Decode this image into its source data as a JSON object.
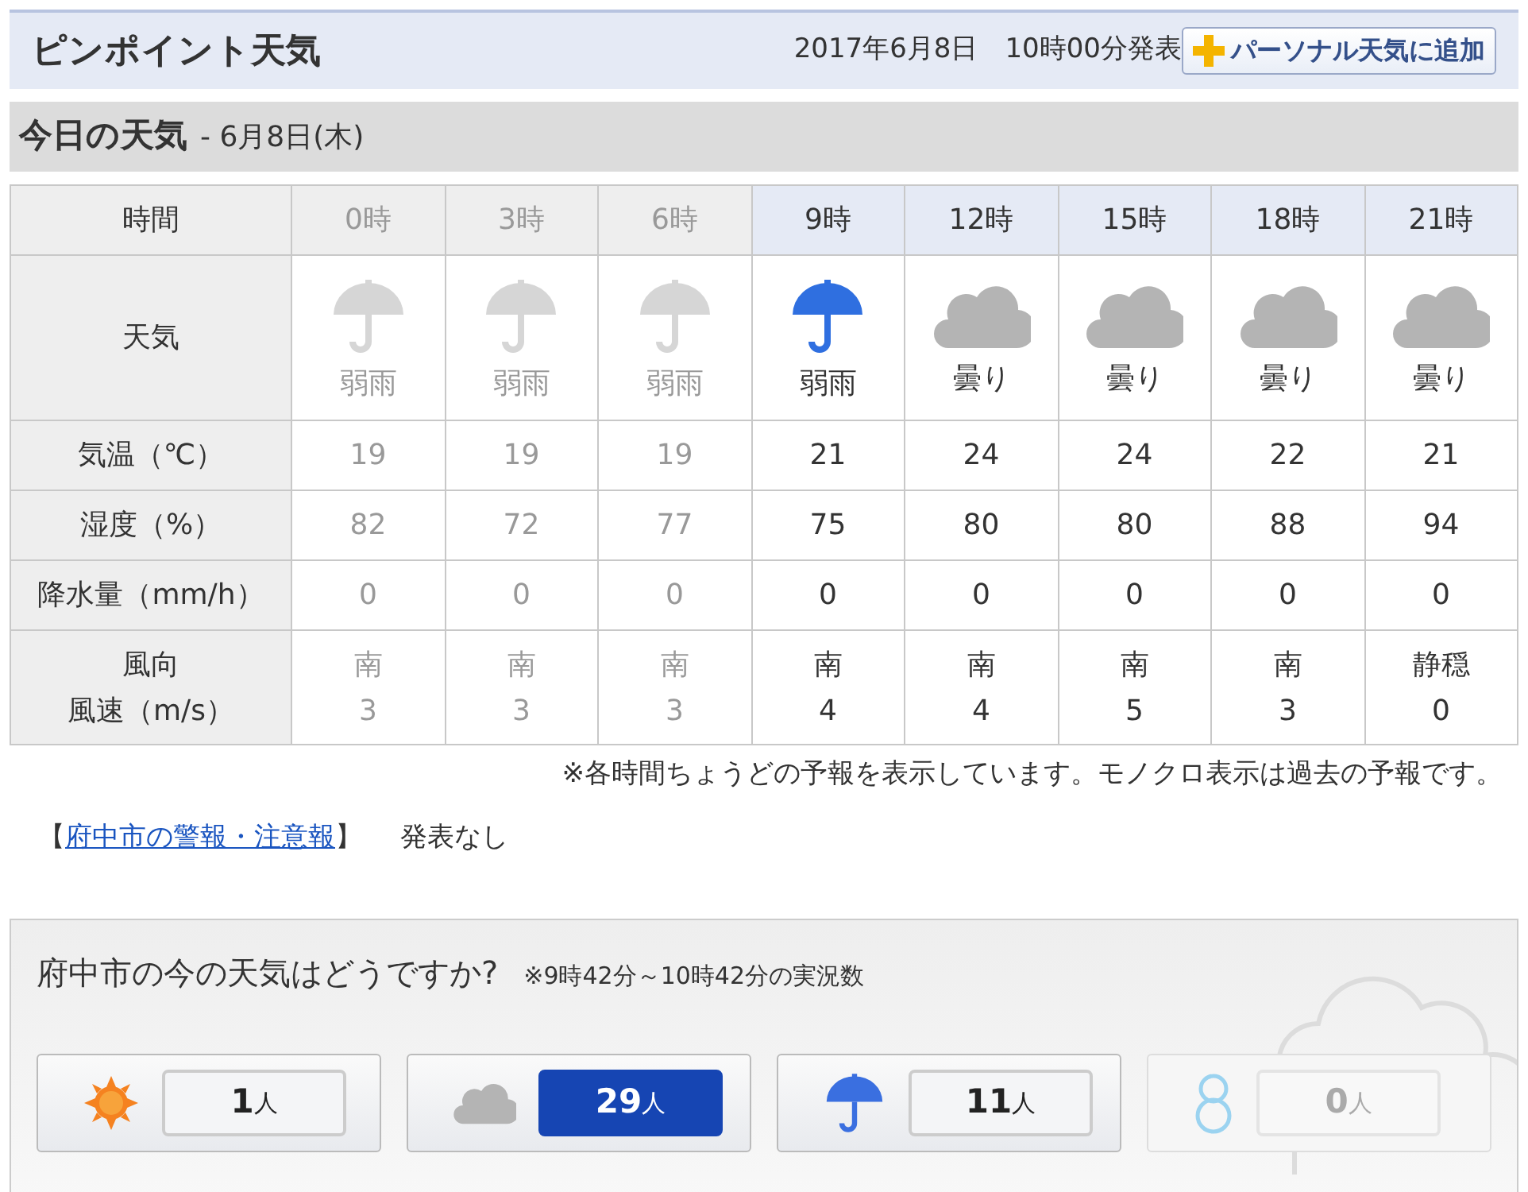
{
  "header": {
    "title": "ピンポイント天気",
    "issued": "2017年6月8日　10時00分発表",
    "add_button": "パーソナル天気に追加"
  },
  "today": {
    "title": "今日の天気",
    "date": "- 6月8日(木)"
  },
  "table": {
    "row_labels": {
      "time": "時間",
      "weather": "天気",
      "temp": "気温（℃）",
      "humidity": "湿度（%）",
      "precip": "降水量（mm/h）",
      "wind_dir": "風向",
      "wind_speed": "風速（m/s）"
    },
    "columns": [
      {
        "time": "0時",
        "past": true,
        "kind": "rain",
        "weather": "弱雨",
        "temp": "19",
        "humidity": "82",
        "precip": "0",
        "wind_dir": "南",
        "wind_speed": "3"
      },
      {
        "time": "3時",
        "past": true,
        "kind": "rain",
        "weather": "弱雨",
        "temp": "19",
        "humidity": "72",
        "precip": "0",
        "wind_dir": "南",
        "wind_speed": "3"
      },
      {
        "time": "6時",
        "past": true,
        "kind": "rain",
        "weather": "弱雨",
        "temp": "19",
        "humidity": "77",
        "precip": "0",
        "wind_dir": "南",
        "wind_speed": "3"
      },
      {
        "time": "9時",
        "past": false,
        "kind": "rain",
        "weather": "弱雨",
        "temp": "21",
        "humidity": "75",
        "precip": "0",
        "wind_dir": "南",
        "wind_speed": "4"
      },
      {
        "time": "12時",
        "past": false,
        "kind": "cloud",
        "weather": "曇り",
        "temp": "24",
        "humidity": "80",
        "precip": "0",
        "wind_dir": "南",
        "wind_speed": "4"
      },
      {
        "time": "15時",
        "past": false,
        "kind": "cloud",
        "weather": "曇り",
        "temp": "24",
        "humidity": "80",
        "precip": "0",
        "wind_dir": "南",
        "wind_speed": "5"
      },
      {
        "time": "18時",
        "past": false,
        "kind": "cloud",
        "weather": "曇り",
        "temp": "22",
        "humidity": "88",
        "precip": "0",
        "wind_dir": "南",
        "wind_speed": "3"
      },
      {
        "time": "21時",
        "past": false,
        "kind": "cloud",
        "weather": "曇り",
        "temp": "21",
        "humidity": "94",
        "precip": "0",
        "wind_dir": "静穏",
        "wind_speed": "0"
      }
    ]
  },
  "note": "※各時間ちょうどの予報を表示しています。モノクロ表示は過去の予報です。",
  "warning": {
    "open": "【",
    "link": "府中市の警報・注意報",
    "close": "】",
    "status": "発表なし"
  },
  "vote": {
    "question": "府中市の今の天気はどうですか?",
    "range": "※9時42分～10時42分の実況数",
    "options": [
      {
        "kind": "sun",
        "count": "1",
        "unit": "人",
        "selected": false,
        "disabled": false
      },
      {
        "kind": "cloud",
        "count": "29",
        "unit": "人",
        "selected": true,
        "disabled": false
      },
      {
        "kind": "rain",
        "count": "11",
        "unit": "人",
        "selected": false,
        "disabled": false
      },
      {
        "kind": "snow",
        "count": "0",
        "unit": "人",
        "selected": false,
        "disabled": true
      }
    ]
  }
}
